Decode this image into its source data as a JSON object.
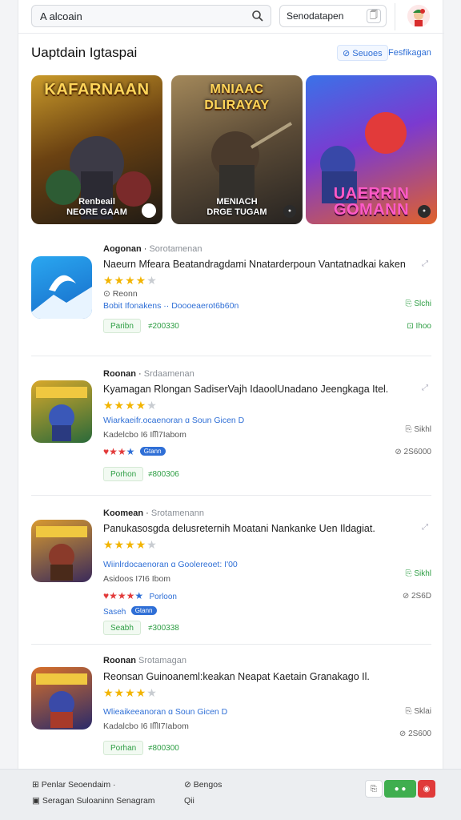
{
  "header": {
    "search_value": "A alcoain",
    "field_value": "Senodatapen",
    "field_icon": "🗍"
  },
  "section": {
    "title": "Uaptdain Igtaspai",
    "chip_a": "⊘ Seuoes",
    "chip_b": "Fesfikagan"
  },
  "banners": [
    {
      "title": "KAFARNAAN",
      "caption": "Renbeail\nNEORE GAAM",
      "colors": [
        "#b77a12",
        "#3a2a10"
      ]
    },
    {
      "title": "MNIAAC DLIRAYAY",
      "caption": "MENIACH\nDRGE TUGAM",
      "colors": [
        "#8a6a40",
        "#37302a"
      ]
    },
    {
      "title": "UAERRIN GOMANN",
      "caption": "",
      "colors": [
        "#2a5fd6",
        "#d83a3a"
      ]
    }
  ],
  "apps": [
    {
      "header": "Aogonan",
      "header_sub": "Sorotamenan",
      "title": "Naeurn Mfeara Beatandragdami Nnatarderpoun Vantatnadkai kaken",
      "rating": 4,
      "meta1": "Reonn",
      "meta2": "Bobit Ifonakens  ··  Doooeaerot6b60n",
      "btn": "Paribn",
      "size": "≠200330",
      "right1": "Slchi",
      "right2": "Ihoo",
      "icon_color": "#1d8de6"
    },
    {
      "header": "Roonan",
      "header_sub": "Srdaamenan",
      "title": "Kyamagan Rlongan SadiserVajh IdaoolUnadano Jeengkaga Itel.",
      "rating": 4,
      "meta1": "Wiarkaeifr.ocaenoran ɑ Soun Gicen D",
      "meta2": "Kadelcbo I6 Iᗰ7Iabom",
      "badge_pill": "Gtann",
      "btn": "Porhon",
      "size": "≠800306",
      "right1": "Sikhl",
      "right2": "2S6000",
      "icon_color": "#3a8a3a"
    },
    {
      "header": "Koomean",
      "header_sub": "Srotamenann",
      "title": "Panukasosgda delusreternih Moatani Nankanke Uen Ildagiat.",
      "rating": 4,
      "meta1": "Wiinlrdocaenoran ɑ Goolereoet: I'00",
      "meta2": "Asidoos I7I6 Ibom",
      "badge_lbl": "Porloon",
      "badge_pill2": "Gtann",
      "badge_prefix": "Saseh",
      "btn": "Seabh",
      "size": "≠300338",
      "right1": "Sikhl",
      "right2": "2S6D",
      "icon_color": "#b84a1a"
    },
    {
      "header": "Roonan",
      "header_sub": "Srotamagan",
      "title": "Reonsan Guinoaneml:keakan Neapat Kaetain Granakago Il.",
      "rating": 4,
      "meta1": "Wlieaikeeanoran ɑ Soun Gicen D",
      "meta2": "Kadalcbo I6 IᗰI7Iabom",
      "btn": "Porhan",
      "size": "≠800300",
      "right1": "Sklai",
      "right2": "2S600",
      "icon_color": "#c0302a"
    }
  ],
  "footer": {
    "l1": "Penlar Seoendaim ·",
    "l2": "Seragan Suloaninn Senagram",
    "m1": "Bengos",
    "m2": "Qii"
  }
}
